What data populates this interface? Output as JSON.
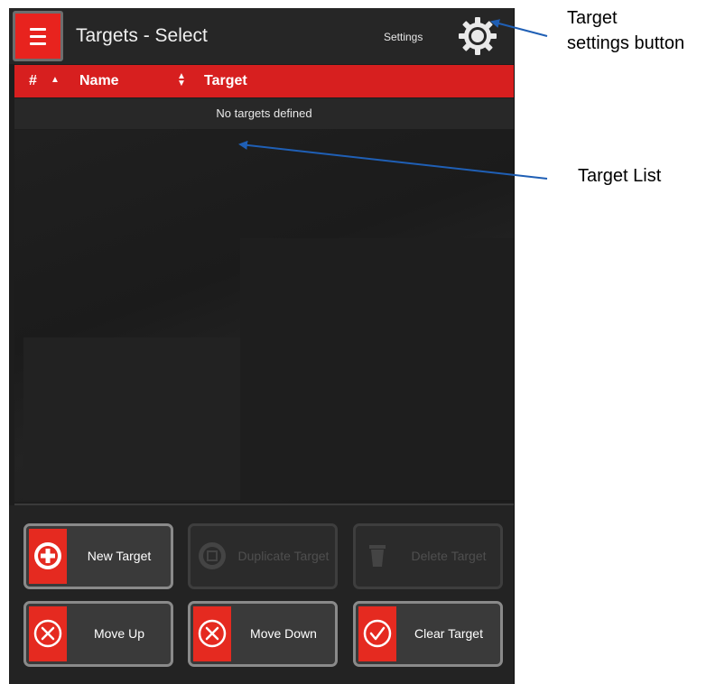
{
  "header": {
    "title": "Targets - Select",
    "settings_label": "Settings"
  },
  "table": {
    "columns": [
      "#",
      "Name",
      "Target"
    ],
    "empty_message": "No targets defined"
  },
  "buttons": [
    {
      "label": "New Target",
      "icon": "plus-circle-icon",
      "enabled": true
    },
    {
      "label": "Duplicate Target",
      "icon": "duplicate-icon",
      "enabled": false
    },
    {
      "label": "Delete Target",
      "icon": "trash-icon",
      "enabled": false
    },
    {
      "label": "Move Up",
      "icon": "x-circle-icon",
      "enabled": true
    },
    {
      "label": "Move Down",
      "icon": "x-circle-icon",
      "enabled": true
    },
    {
      "label": "Clear Target",
      "icon": "check-circle-icon",
      "enabled": true
    }
  ],
  "annotations": {
    "settings_button": [
      "Target",
      "settings button"
    ],
    "target_list": "Target List"
  },
  "colors": {
    "accent": "#e52a20",
    "header_bar": "#d71f1f",
    "background": "#1d1d1d",
    "arrow": "#1f5fb5"
  }
}
